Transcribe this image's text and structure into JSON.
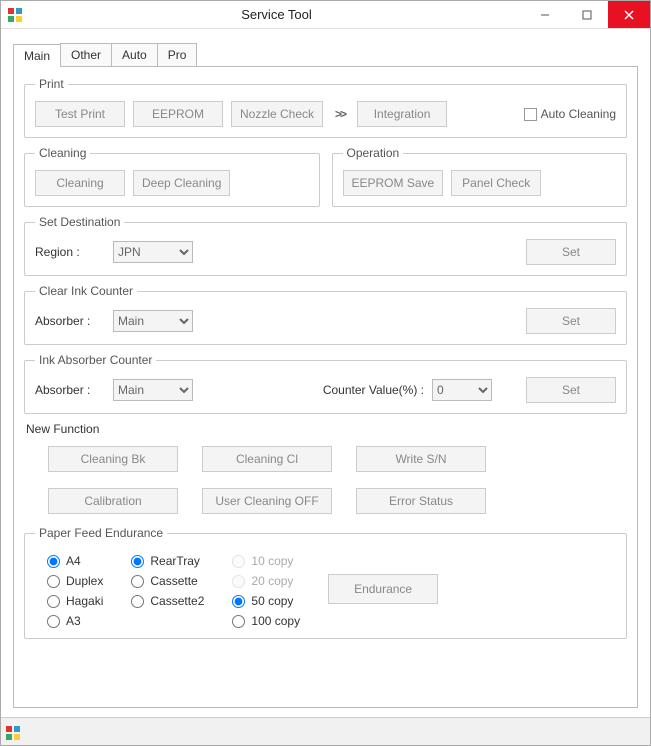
{
  "window": {
    "title": "Service Tool",
    "min": "–",
    "max": "□",
    "close": "×"
  },
  "tabs": {
    "main": "Main",
    "other": "Other",
    "auto": "Auto",
    "pro": "Pro"
  },
  "print": {
    "legend": "Print",
    "test_print": "Test Print",
    "eeprom": "EEPROM",
    "nozzle_check": "Nozzle Check",
    "integration": "Integration",
    "auto_cleaning": "Auto Cleaning"
  },
  "cleaning": {
    "legend": "Cleaning",
    "cleaning": "Cleaning",
    "deep_cleaning": "Deep Cleaning"
  },
  "operation": {
    "legend": "Operation",
    "eeprom_save": "EEPROM Save",
    "panel_check": "Panel Check"
  },
  "set_dest": {
    "legend": "Set Destination",
    "region_label": "Region :",
    "region_value": "JPN",
    "set": "Set"
  },
  "clear_ink": {
    "legend": "Clear Ink Counter",
    "absorber_label": "Absorber :",
    "absorber_value": "Main",
    "set": "Set"
  },
  "ink_abs": {
    "legend": "Ink Absorber Counter",
    "absorber_label": "Absorber :",
    "absorber_value": "Main",
    "counter_label": "Counter Value(%) :",
    "counter_value": "0",
    "set": "Set"
  },
  "new_func": {
    "title": "New Function",
    "cleaning_bk": "Cleaning Bk",
    "cleaning_cl": "Cleaning Cl",
    "write_sn": "Write S/N",
    "calibration": "Calibration",
    "user_cleaning_off": "User Cleaning OFF",
    "error_status": "Error Status"
  },
  "paper_feed": {
    "legend": "Paper Feed Endurance",
    "size": {
      "a4": "A4",
      "duplex": "Duplex",
      "hagaki": "Hagaki",
      "a3": "A3"
    },
    "source": {
      "rear": "RearTray",
      "cassette": "Cassette",
      "cassette2": "Cassette2"
    },
    "copies": {
      "c10": "10 copy",
      "c20": "20 copy",
      "c50": "50 copy",
      "c100": "100 copy"
    },
    "endurance": "Endurance",
    "selected_size": "A4",
    "selected_source": "RearTray",
    "selected_copies": "50 copy"
  }
}
